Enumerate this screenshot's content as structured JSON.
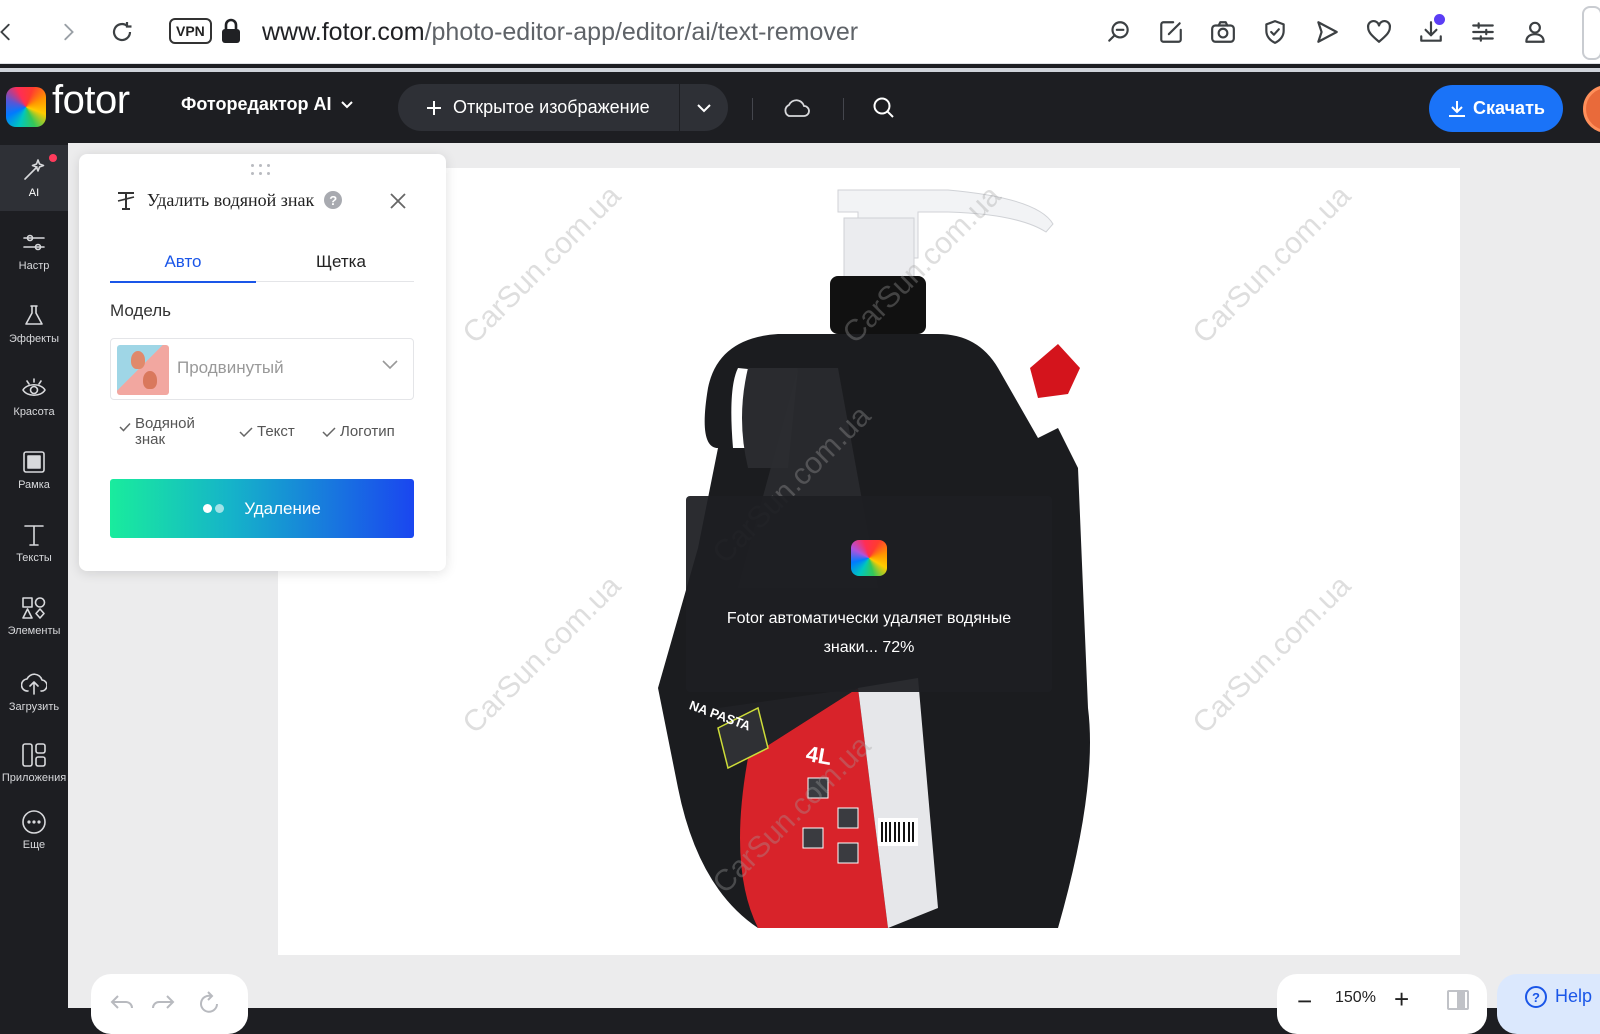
{
  "browser": {
    "vpn_label": "VPN",
    "url_domain": "www.fotor.com",
    "url_path": "/photo-editor-app/editor/ai/text-remover",
    "icons": [
      "back-icon",
      "forward-icon",
      "reload-icon",
      "lock-icon",
      "search-page-icon",
      "edit-icon",
      "camera-icon",
      "shield-icon",
      "send-icon",
      "heart-icon",
      "download-icon",
      "settings-sliders-icon",
      "profile-icon"
    ]
  },
  "app": {
    "logo_text": "fotor",
    "editor_menu": "Фоторедактор AI",
    "open_image": "Открытое изображение",
    "download": "Скачать"
  },
  "sidebar": {
    "items": [
      {
        "label": "AI",
        "icon": "magic-wand-icon"
      },
      {
        "label": "Настр",
        "icon": "adjust-sliders-icon"
      },
      {
        "label": "Эффекты",
        "icon": "flask-icon"
      },
      {
        "label": "Красота",
        "icon": "eye-icon"
      },
      {
        "label": "Рамка",
        "icon": "frame-icon"
      },
      {
        "label": "Тексты",
        "icon": "text-icon"
      },
      {
        "label": "Элементы",
        "icon": "shapes-icon"
      },
      {
        "label": "Загрузить",
        "icon": "upload-cloud-icon"
      },
      {
        "label": "Приложения",
        "icon": "apps-icon"
      },
      {
        "label": "Еще",
        "icon": "more-icon"
      }
    ]
  },
  "panel": {
    "title": "Удалить водяной знак",
    "help": "?",
    "tabs": [
      "Авто",
      "Щетка"
    ],
    "active_tab": "Авто",
    "model_label": "Модель",
    "model_value": "Продвинутый",
    "checks": [
      "Водяной знак",
      "Текст",
      "Логотип"
    ],
    "remove_button": "Удаление"
  },
  "canvas": {
    "watermark_text": "CarSun.com.ua",
    "bottle_volume_label": "4L",
    "bottle_brand_label": "NA PASTA"
  },
  "overlay": {
    "message": "Fotor автоматически удаляет водяные знаки... 72%",
    "progress_percent": 72
  },
  "bottom": {
    "zoom": "150%",
    "help": "Help"
  },
  "colors": {
    "accent": "#1a73f8",
    "tab_active": "#1a56e8",
    "app_bg": "#1d1e22"
  }
}
